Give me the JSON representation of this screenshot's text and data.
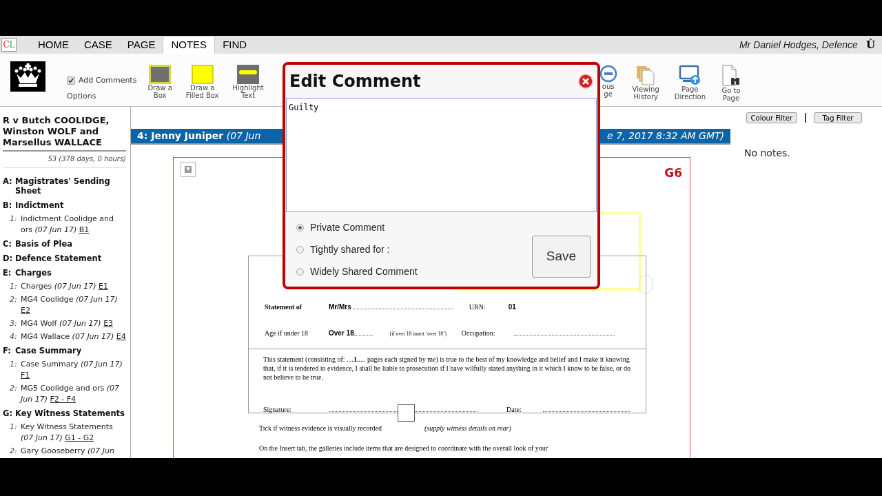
{
  "app_logo": "CL",
  "tabs": [
    {
      "label": "HOME",
      "selected": false
    },
    {
      "label": "CASE",
      "selected": false
    },
    {
      "label": "PAGE",
      "selected": false
    },
    {
      "label": "NOTES",
      "selected": true
    },
    {
      "label": "FIND",
      "selected": false
    }
  ],
  "user": {
    "name": "Mr Daniel Hodges, Defence",
    "glyph": "Ù"
  },
  "toolbar": {
    "add_comments": {
      "label": "Add Comments",
      "checked": true
    },
    "options_label": "Options",
    "left_tools": [
      {
        "kind": "box",
        "label": [
          "Draw a",
          "Box"
        ]
      },
      {
        "kind": "filled-box",
        "label": [
          "Draw a",
          "Filled Box"
        ]
      },
      {
        "kind": "highlight",
        "label": [
          "Highlight",
          "Text"
        ]
      }
    ],
    "right_tools": [
      {
        "kind": "previous",
        "label": [
          "ous",
          "ge"
        ]
      },
      {
        "kind": "history",
        "label": [
          "Viewing",
          "History"
        ]
      },
      {
        "kind": "direction",
        "label": [
          "Page",
          "Direction"
        ]
      },
      {
        "kind": "goto",
        "label": [
          "Go to",
          "Page"
        ]
      }
    ]
  },
  "sidebar": {
    "case_title": "R v Butch COOLIDGE, Winston WOLF and Marsellus WALLACE",
    "case_duration": "53 (378 days, 0 hours)",
    "sections": [
      {
        "letter": "A:",
        "title": "Magistrates' Sending Sheet"
      },
      {
        "letter": "B:",
        "title": "Indictment",
        "documents": [
          {
            "number": "1:",
            "title": "Indictment Coolidge and ors",
            "date": "(07 Jun 17)",
            "pages": "B1"
          }
        ]
      },
      {
        "letter": "C:",
        "title": "Basis of Plea"
      },
      {
        "letter": "D:",
        "title": "Defence Statement"
      },
      {
        "letter": "E:",
        "title": "Charges",
        "documents": [
          {
            "number": "1:",
            "title": "Charges",
            "date": "(07 Jun 17)",
            "pages": "E1"
          },
          {
            "number": "2:",
            "title": "MG4 Coolidge",
            "date": "(07 Jun 17)",
            "pages": "E2"
          },
          {
            "number": "3:",
            "title": "MG4 Wolf",
            "date": "(07 Jun 17)",
            "pages": "E3"
          },
          {
            "number": "4:",
            "title": "MG4 Wallace",
            "date": "(07 Jun 17)",
            "pages": "E4"
          }
        ]
      },
      {
        "letter": "F:",
        "title": "Case Summary",
        "documents": [
          {
            "number": "1:",
            "title": "Case Summary",
            "date": "(07 Jun 17)",
            "pages": "F1"
          },
          {
            "number": "2:",
            "title": "MG5 Coolidge and ors",
            "date": "(07 Jun 17)",
            "pages": "F2 - F4"
          }
        ]
      },
      {
        "letter": "G:",
        "title": "Key Witness Statements",
        "documents": [
          {
            "number": "1:",
            "title": "Key Witness Statements",
            "date": "(07 Jun 17)",
            "pages": "G1 - G2"
          },
          {
            "number": "2:",
            "title": "Gary Gooseberry",
            "date": "(07 Jun"
          }
        ]
      }
    ]
  },
  "filters": [
    "Colour Filter",
    "Tag Filter"
  ],
  "document_header": {
    "title": "4: Jenny Juniper",
    "date_start": "(07 Jun",
    "date_end": "e 7, 2017 8:32 AM GMT)"
  },
  "page": {
    "page_label": "G6",
    "form": {
      "statement_label": "Statement of",
      "name_value": "Mr/Mrs",
      "urn_label": "URN:",
      "urn_value": "01",
      "age_label": "Age if under 18",
      "age_value": "Over 18",
      "age_hint": "(if over 18 insert ‘over 18’)",
      "occupation_label": "Occupation:",
      "declaration": "This statement  (consisting of: ....**1**.....   pages each signed by me) is true to the best of my knowledge and belief and I make it knowing that, if it is tendered in evidence, I shall be liable to prosecution if I have wilfully stated anything in it which I know to be false, or do not believe to be true.",
      "signature_label": "Signature:",
      "date_label": "Date:",
      "visual_record_checked": false
    },
    "tick_text": "Tick if witness evidence is visually recorded",
    "tick_hint": "(supply witness details on rear)",
    "body_text": "On the Insert tab, the galleries include items that are designed to coordinate with the overall look of your"
  },
  "notes": {
    "empty_text": "No notes."
  },
  "dialog": {
    "title": "Edit Comment",
    "comment": "Guilty",
    "sharing": [
      {
        "label": "Private Comment",
        "selected": true
      },
      {
        "label": "Tightly shared for :",
        "selected": false
      },
      {
        "label": "Widely Shared Comment",
        "selected": false
      }
    ],
    "save_label": "Save"
  }
}
